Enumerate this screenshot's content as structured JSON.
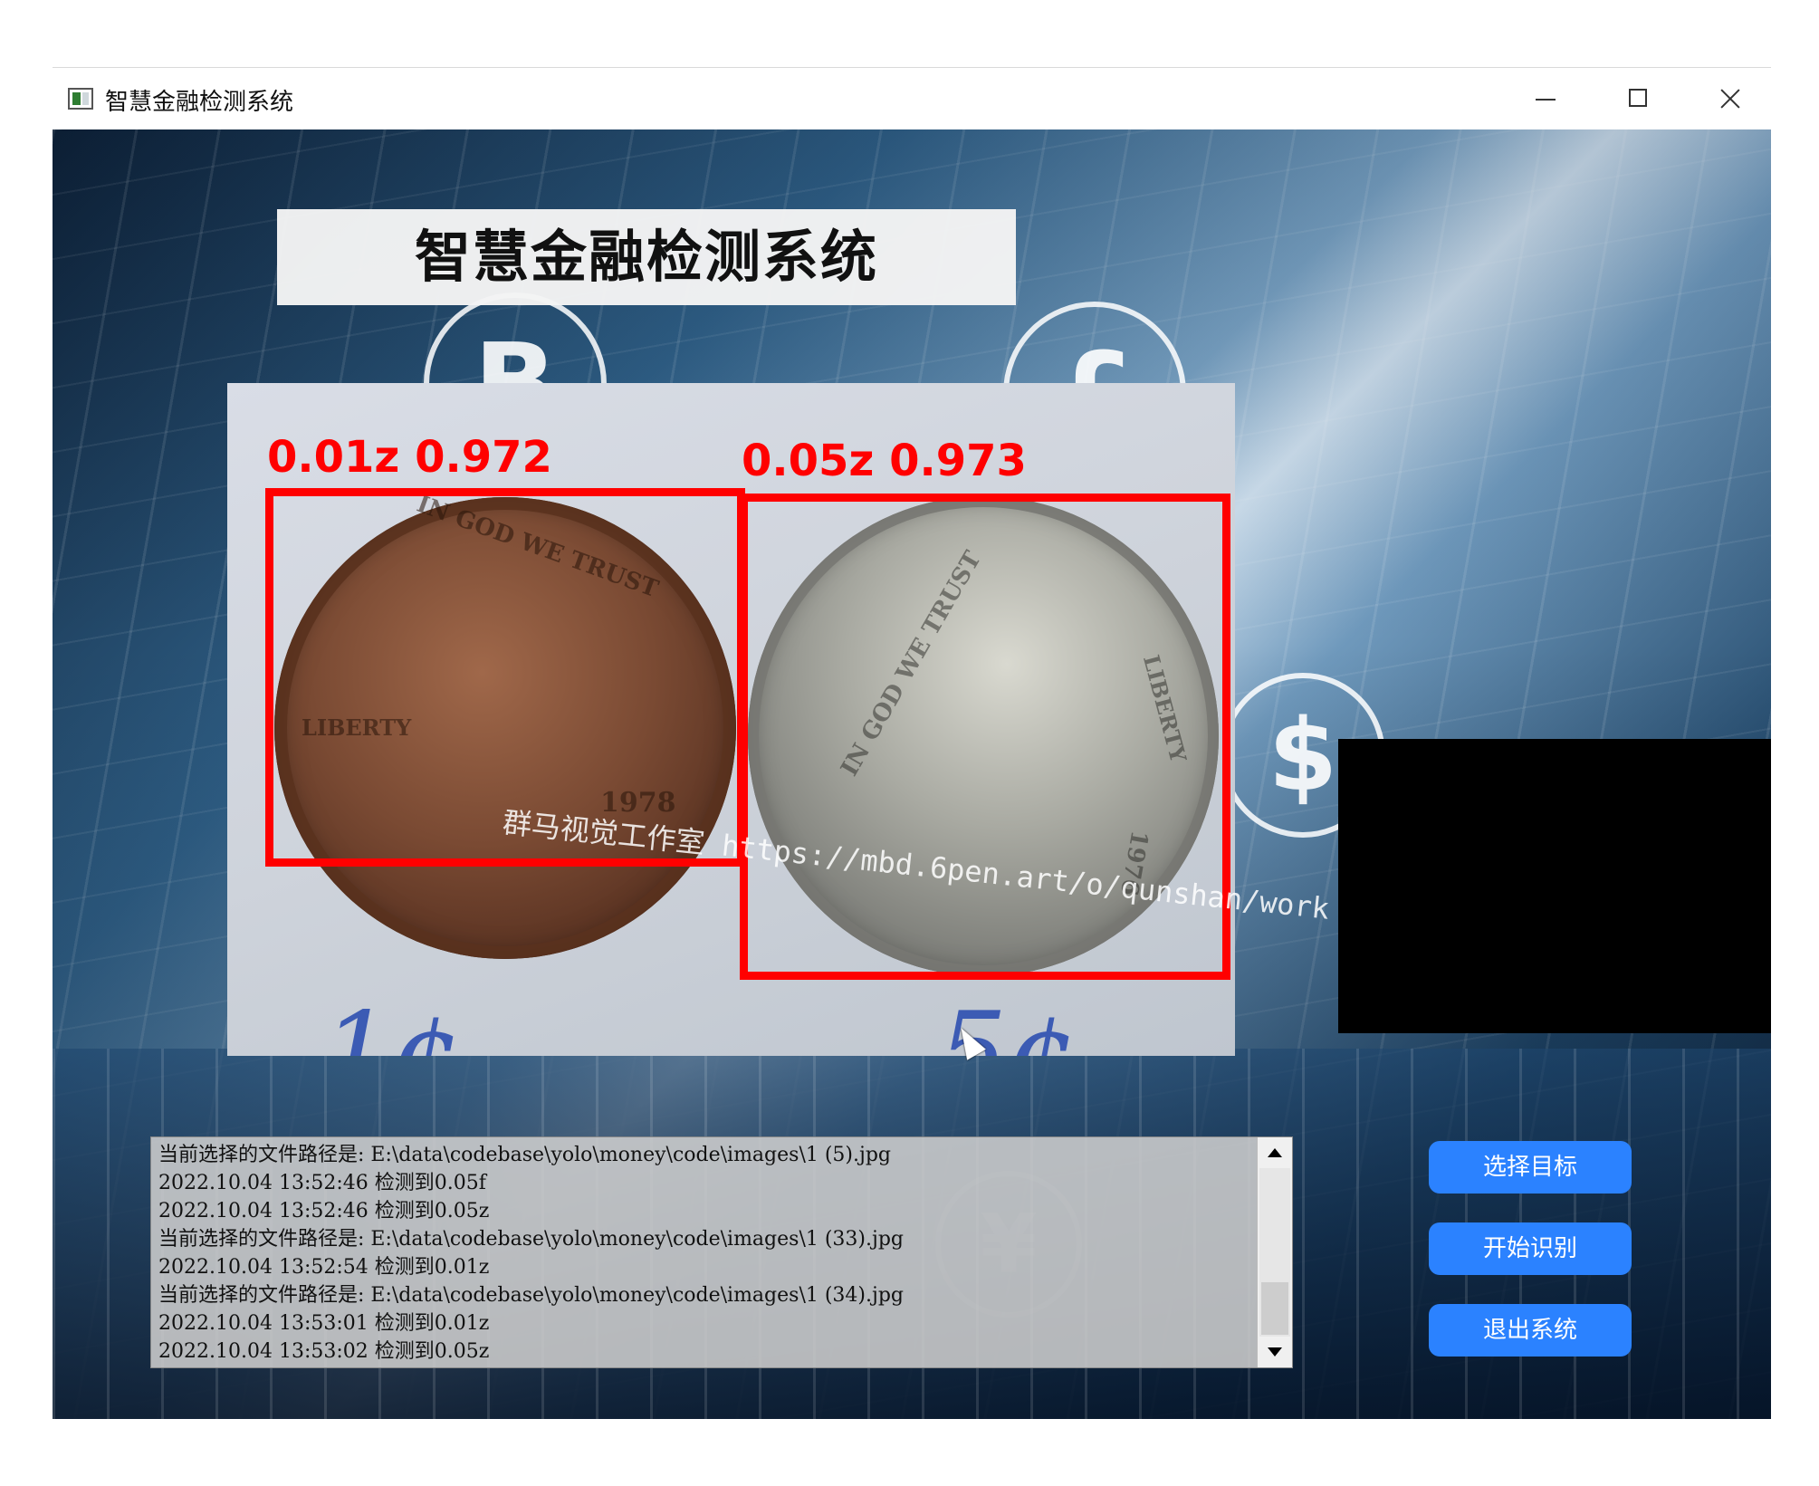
{
  "window": {
    "title": "智慧金融检测系统",
    "controls": {
      "minimize": "minimize-icon",
      "maximize": "maximize-icon",
      "close": "close-icon"
    }
  },
  "header": {
    "title": "智慧金融检测系统"
  },
  "detection": {
    "boxes": [
      {
        "label": "0.01z 0.972",
        "color": "#ff0000"
      },
      {
        "label": "0.05z 0.973",
        "color": "#ff0000"
      }
    ],
    "handwritten": [
      "1¢",
      "5¢"
    ],
    "coin_texts": [
      "IN GOD WE TRUST",
      "LIBERTY",
      "1978",
      "IN GOD WE TRUST",
      "LIBERTY",
      "1976"
    ]
  },
  "watermark": "群马视觉工作室 https://mbd.6pen.art/o/qunshan/work",
  "log": {
    "lines": [
      "当前选择的文件路径是: E:\\data\\codebase\\yolo\\money\\code\\images\\1 (5).jpg",
      "2022.10.04 13:52:46 检测到0.05f",
      "2022.10.04 13:52:46 检测到0.05z",
      "当前选择的文件路径是: E:\\data\\codebase\\yolo\\money\\code\\images\\1 (33).jpg",
      "2022.10.04 13:52:54 检测到0.01z",
      "当前选择的文件路径是: E:\\data\\codebase\\yolo\\money\\code\\images\\1 (34).jpg",
      "2022.10.04 13:53:01 检测到0.01z",
      "2022.10.04 13:53:02 检测到0.05z"
    ]
  },
  "buttons": {
    "select": "选择目标",
    "start": "开始识别",
    "exit": "退出系统",
    "color": "#2b82ff"
  },
  "background_symbols": [
    "B",
    "£",
    "$",
    "¥"
  ]
}
